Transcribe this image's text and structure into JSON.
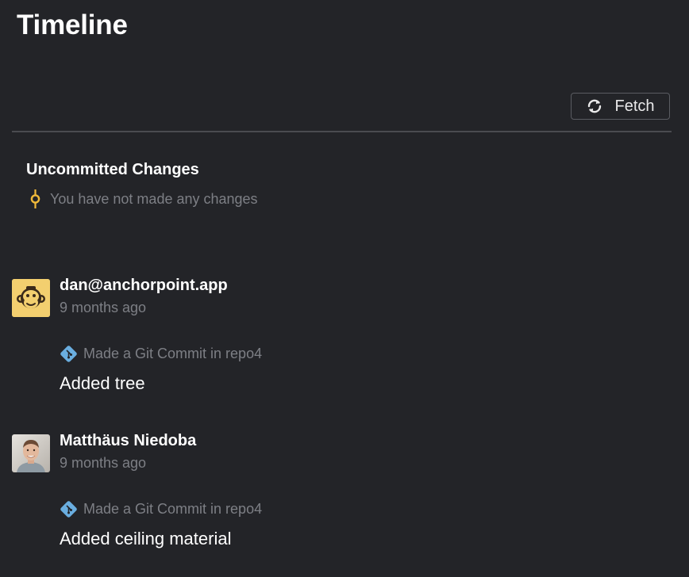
{
  "header": {
    "title": "Timeline",
    "fetch_label": "Fetch"
  },
  "uncommitted": {
    "title": "Uncommitted Changes",
    "empty_text": "You have not made any changes"
  },
  "entries": [
    {
      "author": "dan@anchorpoint.app",
      "time": "9 months ago",
      "action": "Made a Git Commit in repo4",
      "message": "Added tree",
      "avatar": "monkey-avatar"
    },
    {
      "author": "Matthäus Niedoba",
      "time": "9 months ago",
      "action": "Made a Git Commit in repo4",
      "message": "Added ceiling material",
      "avatar": "person-photo-avatar"
    }
  ],
  "colors": {
    "background": "#232428",
    "muted_text": "#7d7f85",
    "git_icon": "#6aaee0",
    "change_icon": "#f0b93a",
    "monkey_avatar_bg": "#f3cf6f"
  }
}
